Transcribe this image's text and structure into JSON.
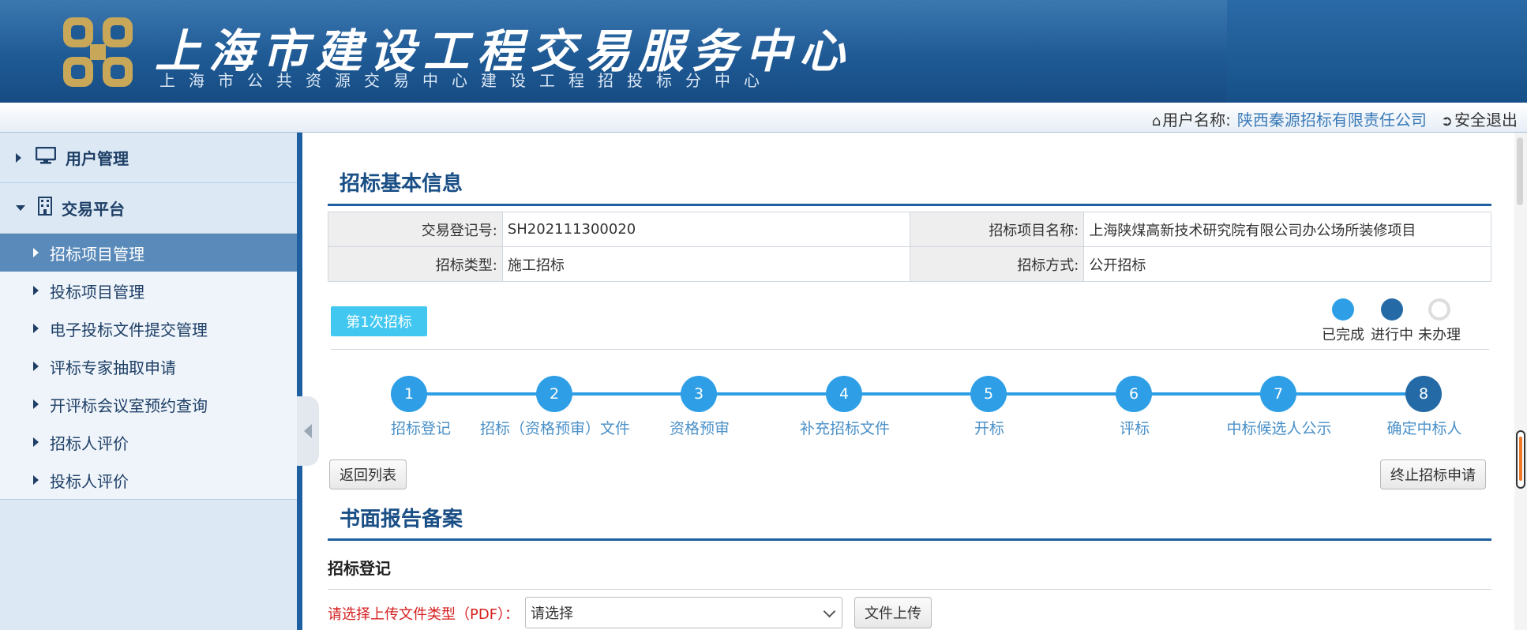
{
  "header": {
    "title": "上海市建设工程交易服务中心",
    "subtitle": "上海市公共资源交易中心建设工程招投标分中心"
  },
  "userbar": {
    "user_label": "用户名称:",
    "user_name": "陕西秦源招标有限责任公司",
    "logout": "安全退出"
  },
  "sidebar": {
    "groups": [
      {
        "label": "用户管理",
        "icon": "monitor-icon",
        "expanded": false
      },
      {
        "label": "交易平台",
        "icon": "building-icon",
        "expanded": true
      }
    ],
    "items": [
      {
        "label": "招标项目管理",
        "active": true
      },
      {
        "label": "投标项目管理"
      },
      {
        "label": "电子投标文件提交管理"
      },
      {
        "label": "评标专家抽取申请"
      },
      {
        "label": "开评标会议室预约查询"
      },
      {
        "label": "招标人评价"
      },
      {
        "label": "投标人评价"
      }
    ]
  },
  "main": {
    "section1_title": "招标基本信息",
    "info": {
      "reg_no_label": "交易登记号:",
      "reg_no": "SH202111300020",
      "project_name_label": "招标项目名称:",
      "project_name": "上海陕煤高新技术研究院有限公司办公场所装修项目",
      "type_label": "招标类型:",
      "type": "施工招标",
      "method_label": "招标方式:",
      "method": "公开招标"
    },
    "round_button": "第1次招标",
    "legend": {
      "done": "已完成",
      "in_progress": "进行中",
      "pending": "未办理"
    },
    "steps": [
      {
        "num": "1",
        "label": "招标登记"
      },
      {
        "num": "2",
        "label": "招标（资格预审）文件"
      },
      {
        "num": "3",
        "label": "资格预审"
      },
      {
        "num": "4",
        "label": "补充招标文件"
      },
      {
        "num": "5",
        "label": "开标"
      },
      {
        "num": "6",
        "label": "评标"
      },
      {
        "num": "7",
        "label": "中标候选人公示"
      },
      {
        "num": "8",
        "label": "确定中标人",
        "current": true
      }
    ],
    "back_button": "返回列表",
    "terminate_button": "终止招标申请",
    "section2_title": "书面报告备案",
    "sub_heading": "招标登记",
    "upload_label": "请选择上传文件类型（PDF）：",
    "select_value": "请选择",
    "upload_button": "文件上传"
  },
  "colors": {
    "brand_blue": "#1d5fa0",
    "step_blue": "#2e9fe6",
    "step_current": "#246aa6",
    "round_button": "#42c8f0",
    "required_red": "#d62020"
  }
}
